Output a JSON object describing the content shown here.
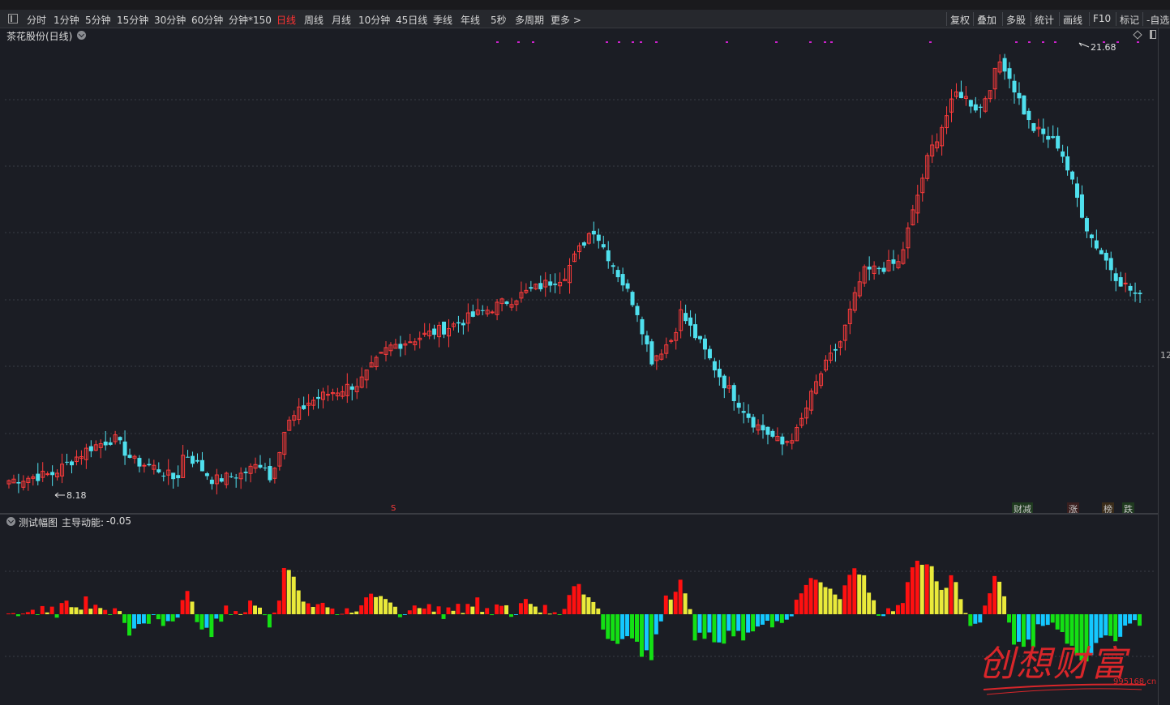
{
  "toolbar": {
    "periods": [
      "分时",
      "1分钟",
      "5分钟",
      "15分钟",
      "30分钟",
      "60分钟",
      "分钟*150",
      "日线",
      "周线",
      "月线",
      "10分钟",
      "45日线",
      "季线",
      "年线",
      "5秒",
      "多周期",
      "更多 >"
    ],
    "active_period": "日线",
    "right_buttons": [
      "复权",
      "叠加",
      "多股",
      "统计",
      "画线",
      "F10",
      "标记",
      "-自选"
    ]
  },
  "main_chart": {
    "title": "茶花股份(日线)",
    "max_label": "21.68",
    "min_label": "8.18",
    "axis_tick": "12",
    "s_marker": "S",
    "badges": [
      {
        "text": "财减",
        "color": "#3fd43f"
      },
      {
        "text": "涨",
        "color": "#ff4040"
      },
      {
        "text": "榜",
        "color": "#ff9a20"
      },
      {
        "text": "跌",
        "color": "#3fd43f"
      }
    ],
    "colors": {
      "up": "#ff3b3b",
      "down": "#4fe0ee",
      "grid": "#3a3d46",
      "marker": "#cc22cc"
    }
  },
  "sub_chart": {
    "title": "测试幅图",
    "indicator_label": "主导动能:",
    "indicator_value": "-0.05",
    "colors": {
      "red": "#ff1010",
      "yellow": "#eaea3a",
      "green": "#14e014",
      "cyan": "#14c8ff"
    }
  },
  "watermark": {
    "text": "创想财富",
    "url": "995168.cn"
  },
  "chart_data": [
    {
      "type": "candlestick",
      "title": "茶花股份(日线)",
      "series_desc": "daily close (approx.)",
      "points": 235,
      "anchors": [
        [
          0,
          8.3
        ],
        [
          30,
          8.5
        ],
        [
          55,
          9.3
        ],
        [
          72,
          9.6
        ],
        [
          85,
          8.9
        ],
        [
          100,
          8.7
        ],
        [
          115,
          8.3
        ],
        [
          120,
          9.2
        ],
        [
          140,
          8.3
        ],
        [
          160,
          8.5
        ],
        [
          175,
          8.9
        ],
        [
          178,
          8.2
        ],
        [
          190,
          10.0
        ],
        [
          205,
          10.7
        ],
        [
          220,
          11.0
        ],
        [
          240,
          11.3
        ],
        [
          260,
          12.4
        ],
        [
          300,
          13.0
        ],
        [
          380,
          14.6
        ],
        [
          400,
          16.1
        ],
        [
          430,
          13.6
        ],
        [
          440,
          12.0
        ],
        [
          455,
          12.7
        ],
        [
          460,
          13.5
        ],
        [
          490,
          11.3
        ],
        [
          510,
          10.1
        ],
        [
          530,
          9.4
        ],
        [
          540,
          9.8
        ],
        [
          555,
          11.5
        ],
        [
          570,
          12.6
        ],
        [
          585,
          14.7
        ],
        [
          610,
          15.0
        ],
        [
          630,
          18.3
        ],
        [
          650,
          20.3
        ],
        [
          665,
          19.7
        ],
        [
          680,
          21.3
        ],
        [
          700,
          19.2
        ],
        [
          720,
          18.6
        ],
        [
          740,
          15.9
        ],
        [
          760,
          14.5
        ],
        [
          775,
          13.9
        ]
      ]
    },
    {
      "type": "bar",
      "title": "测试幅图",
      "series_desc": "主导动能",
      "last_value": -0.05
    }
  ]
}
